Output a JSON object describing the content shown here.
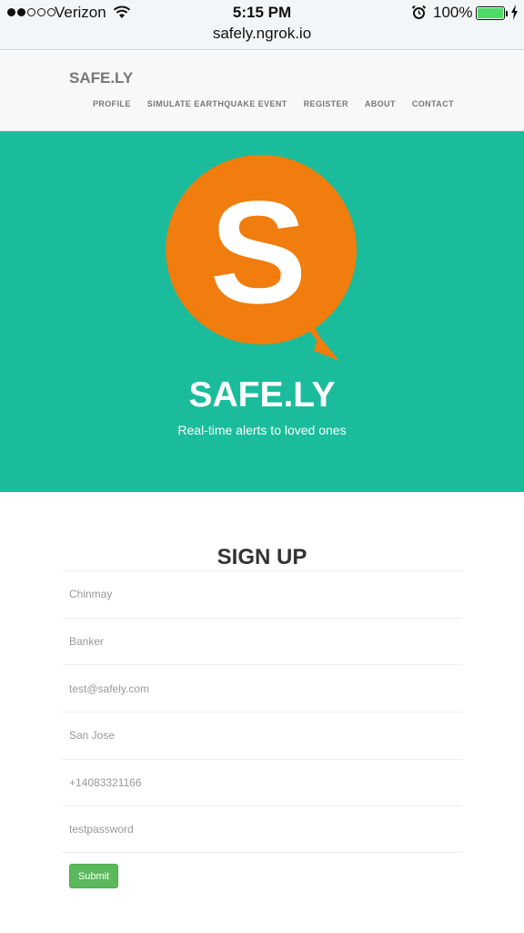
{
  "status_bar": {
    "carrier": "Verizon",
    "time": "5:15 PM",
    "battery_percent": "100%",
    "battery_level": 1.0,
    "signal_strength_dots": 2,
    "url": "safely.ngrok.io"
  },
  "navbar": {
    "brand": "SAFE.LY",
    "links": [
      "PROFILE",
      "SIMULATE EARTHQUAKE EVENT",
      "REGISTER",
      "ABOUT",
      "CONTACT"
    ]
  },
  "hero": {
    "logo_letter": "S",
    "title": "SAFE.LY",
    "subtitle": "Real-time alerts to loved ones"
  },
  "signup": {
    "title": "SIGN UP",
    "fields": [
      {
        "placeholder": "Chinmay"
      },
      {
        "placeholder": "Banker"
      },
      {
        "placeholder": "test@safely.com"
      },
      {
        "placeholder": "San Jose"
      },
      {
        "placeholder": "+14083321166"
      },
      {
        "placeholder": "testpassword"
      }
    ],
    "submit_label": "Submit"
  },
  "colors": {
    "hero_bg": "#1abc9c",
    "logo_orange": "#f07d0d",
    "submit_green": "#5cb85c",
    "battery_green": "#4cd964"
  }
}
